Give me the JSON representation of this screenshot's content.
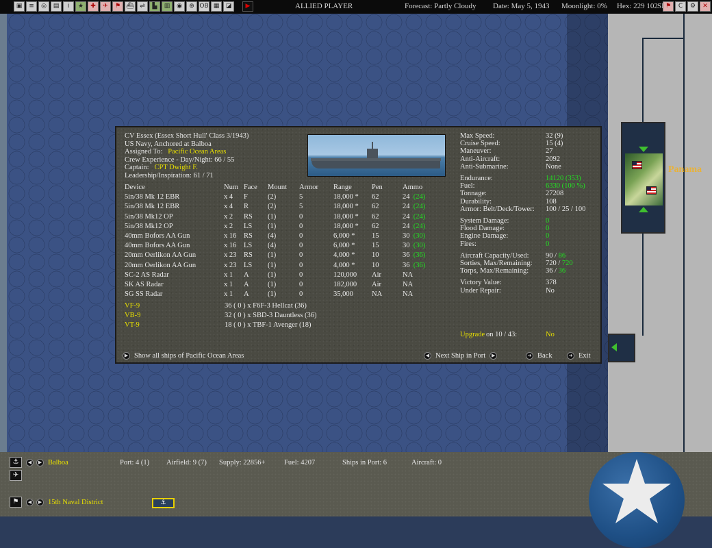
{
  "topbar": {
    "title": "ALLIED PLAYER",
    "forecast": "Forecast: Partly Cloudy",
    "date": "Date: May 5, 1943",
    "moonlight": "Moonlight: 0%",
    "hex": "Hex: 229 102",
    "sl": "SL:"
  },
  "map": {
    "location_label": "Panama"
  },
  "ship": {
    "title": "CV Essex (Essex Short Hull' Class 3/1943)",
    "status": "US Navy, Anchored at Balboa",
    "assigned_label": "Assigned To:",
    "assigned_value": "Pacific Ocean Areas",
    "crew_exp": "Crew Experience - Day/Night: 66 / 55",
    "captain_label": "Captain:",
    "captain_value": "CPT Dwight F.",
    "leadership": "Leadership/Inspiration: 61 / 71"
  },
  "devices": {
    "headers": [
      "Device",
      "Num",
      "Face",
      "Mount",
      "Armor",
      "Range",
      "Pen",
      "Ammo"
    ],
    "rows": [
      {
        "device": "5in/38 Mk 12 EBR",
        "num": "x 4",
        "face": "F",
        "mount": "(2)",
        "armor": "5",
        "range": "18,000 *",
        "pen": "62",
        "ammo": "24",
        "ammo_max": "(24)"
      },
      {
        "device": "5in/38 Mk 12 EBR",
        "num": "x 4",
        "face": "R",
        "mount": "(2)",
        "armor": "5",
        "range": "18,000 *",
        "pen": "62",
        "ammo": "24",
        "ammo_max": "(24)"
      },
      {
        "device": "5in/38 Mk12 OP",
        "num": "x 2",
        "face": "RS",
        "mount": "(1)",
        "armor": "0",
        "range": "18,000 *",
        "pen": "62",
        "ammo": "24",
        "ammo_max": "(24)"
      },
      {
        "device": "5in/38 Mk12 OP",
        "num": "x 2",
        "face": "LS",
        "mount": "(1)",
        "armor": "0",
        "range": "18,000 *",
        "pen": "62",
        "ammo": "24",
        "ammo_max": "(24)"
      },
      {
        "device": "40mm Bofors AA Gun",
        "num": "x 16",
        "face": "RS",
        "mount": "(4)",
        "armor": "0",
        "range": "6,000 *",
        "pen": "15",
        "ammo": "30",
        "ammo_max": "(30)"
      },
      {
        "device": "40mm Bofors AA Gun",
        "num": "x 16",
        "face": "LS",
        "mount": "(4)",
        "armor": "0",
        "range": "6,000 *",
        "pen": "15",
        "ammo": "30",
        "ammo_max": "(30)"
      },
      {
        "device": "20mm Oerlikon AA Gun",
        "num": "x 23",
        "face": "RS",
        "mount": "(1)",
        "armor": "0",
        "range": "4,000 *",
        "pen": "10",
        "ammo": "36",
        "ammo_max": "(36)"
      },
      {
        "device": "20mm Oerlikon AA Gun",
        "num": "x 23",
        "face": "LS",
        "mount": "(1)",
        "armor": "0",
        "range": "4,000 *",
        "pen": "10",
        "ammo": "36",
        "ammo_max": "(36)"
      },
      {
        "device": "SC-2 AS Radar",
        "num": "x 1",
        "face": "A",
        "mount": "(1)",
        "armor": "0",
        "range": "120,000",
        "pen": "Air",
        "ammo": "NA",
        "ammo_max": ""
      },
      {
        "device": "SK AS Radar",
        "num": "x 1",
        "face": "A",
        "mount": "(1)",
        "armor": "0",
        "range": "182,000",
        "pen": "Air",
        "ammo": "NA",
        "ammo_max": ""
      },
      {
        "device": "SG SS Radar",
        "num": "x 1",
        "face": "A",
        "mount": "(1)",
        "armor": "0",
        "range": "35,000",
        "pen": "NA",
        "ammo": "NA",
        "ammo_max": ""
      }
    ]
  },
  "air_groups": [
    {
      "squadron": "VF-9",
      "detail": "36 ( 0 ) x F6F-3 Hellcat (36)"
    },
    {
      "squadron": "VB-9",
      "detail": "32 ( 0 ) x SBD-3 Dauntless (36)"
    },
    {
      "squadron": "VT-9",
      "detail": "18 ( 0 ) x TBF-1 Avenger (18)"
    }
  ],
  "stats": {
    "max_speed": {
      "label": "Max Speed:",
      "value": "32 (9)"
    },
    "cruise_speed": {
      "label": "Cruise Speed:",
      "value": "15 (4)"
    },
    "maneuver": {
      "label": "Maneuver:",
      "value": "27"
    },
    "anti_aircraft": {
      "label": "Anti-Aircraft:",
      "value": "2092"
    },
    "anti_submarine": {
      "label": "Anti-Submarine:",
      "value": "None"
    },
    "endurance": {
      "label": "Endurance:",
      "value": "14120 (353)"
    },
    "fuel": {
      "label": "Fuel:",
      "value": "6330 (100 %)"
    },
    "tonnage": {
      "label": "Tonnage:",
      "value": "27208"
    },
    "durability": {
      "label": "Durability:",
      "value": "108"
    },
    "armor": {
      "label": "Armor: Belt/Deck/Tower:",
      "value": "100 / 25 / 100"
    },
    "system_damage": {
      "label": "System Damage:",
      "value": "0"
    },
    "flood_damage": {
      "label": "Flood Damage:",
      "value": "0"
    },
    "engine_damage": {
      "label": "Engine Damage:",
      "value": "0"
    },
    "fires": {
      "label": "Fires:",
      "value": "0"
    },
    "aircraft_capacity": {
      "label": "Aircraft Capacity/Used:",
      "value": "90 /",
      "value2": "86"
    },
    "sorties": {
      "label": "Sorties, Max/Remaining:",
      "value": "720 /",
      "value2": "720"
    },
    "torps": {
      "label": "Torps, Max/Remaining:",
      "value": "36 /",
      "value2": "36"
    },
    "victory_value": {
      "label": "Victory Value:",
      "value": "378"
    },
    "under_repair": {
      "label": "Under Repair:",
      "value": "No"
    }
  },
  "upgrade": {
    "label": "Upgrade",
    "on": "on 10 / 43:",
    "value": "No"
  },
  "buttons": {
    "show_all": "Show all ships of Pacific Ocean Areas",
    "next_ship": "Next Ship in Port",
    "back": "Back",
    "exit": "Exit"
  },
  "bottom": {
    "port_name": "Balboa",
    "port": "Port: 4 (1)",
    "airfield": "Airfield: 9 (7)",
    "supply": "Supply: 22856+",
    "fuel": "Fuel: 4207",
    "ships_in_port": "Ships in Port: 6",
    "aircraft": "Aircraft: 0",
    "district": "15th Naval District"
  },
  "colors": {
    "highlight_yellow": "#e8e000",
    "value_green": "#22e022",
    "sea_blue": "#3b5284"
  }
}
